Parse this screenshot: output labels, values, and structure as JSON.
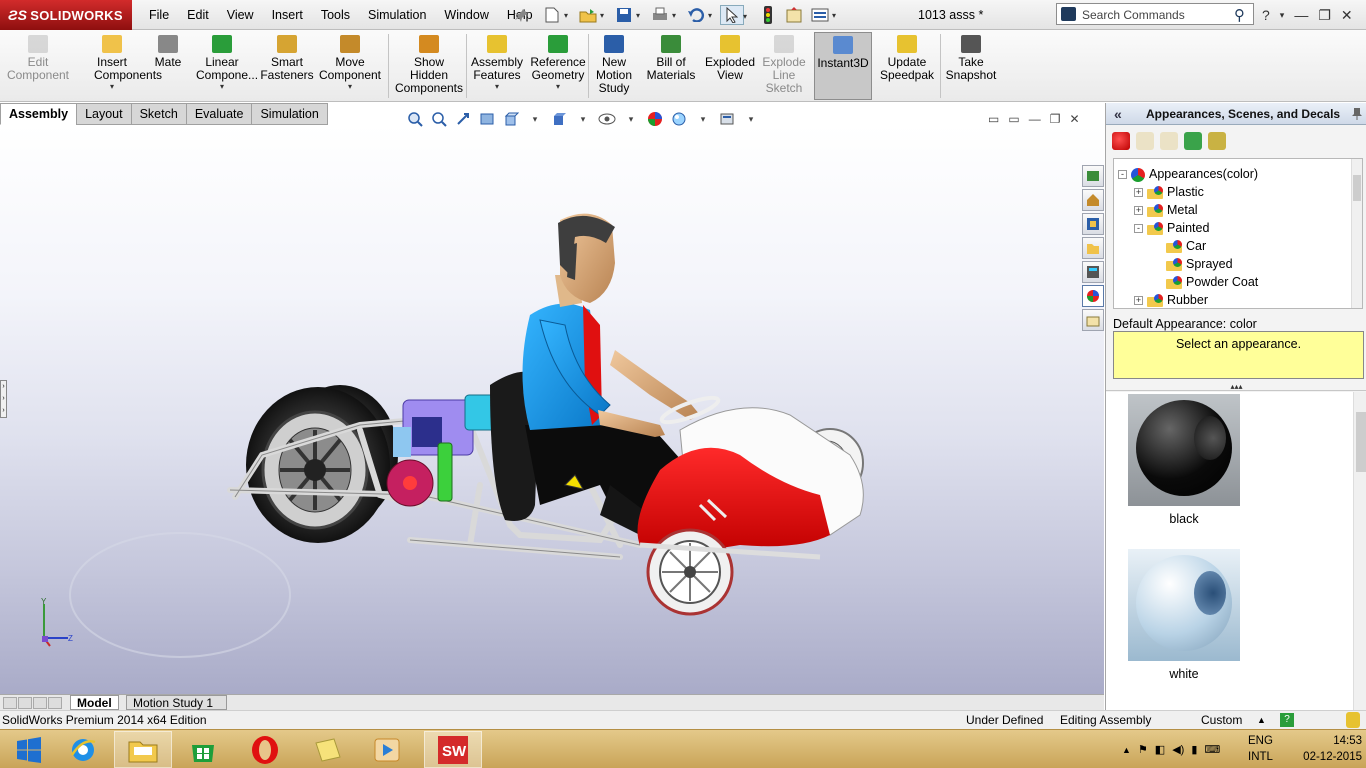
{
  "app": {
    "brand": "SOLIDWORKS",
    "document_title": "1013 asss *"
  },
  "menu": [
    "File",
    "Edit",
    "View",
    "Insert",
    "Tools",
    "Simulation",
    "Window",
    "Help"
  ],
  "search": {
    "placeholder": "Search Commands"
  },
  "toolbar": {
    "tools": [
      {
        "label": "Edit\nComponent",
        "icon": "edit-component-icon",
        "disabled": true
      },
      {
        "label": "Insert\nComponents",
        "icon": "insert-components-icon",
        "dropdown": true
      },
      {
        "label": "Mate",
        "icon": "mate-icon"
      },
      {
        "label": "Linear\nCompone...",
        "icon": "linear-pattern-icon",
        "dropdown": true
      },
      {
        "label": "Smart\nFasteners",
        "icon": "smart-fasteners-icon"
      },
      {
        "label": "Move\nComponent",
        "icon": "move-component-icon",
        "dropdown": true
      },
      {
        "label": "Show\nHidden\nComponents",
        "icon": "show-hidden-icon"
      },
      {
        "label": "Assembly\nFeatures",
        "icon": "assembly-features-icon",
        "dropdown": true
      },
      {
        "label": "Reference\nGeometry",
        "icon": "reference-geometry-icon",
        "dropdown": true
      },
      {
        "label": "New\nMotion\nStudy",
        "icon": "motion-study-icon"
      },
      {
        "label": "Bill of\nMaterials",
        "icon": "bom-icon"
      },
      {
        "label": "Exploded\nView",
        "icon": "exploded-view-icon"
      },
      {
        "label": "Explode\nLine\nSketch",
        "icon": "explode-line-icon",
        "disabled": true
      },
      {
        "label": "Instant3D",
        "icon": "instant3d-icon",
        "active": true
      },
      {
        "label": "Update\nSpeedpak",
        "icon": "speedpak-icon"
      },
      {
        "label": "Take\nSnapshot",
        "icon": "snapshot-icon"
      }
    ]
  },
  "command_tabs": [
    {
      "label": "Assembly",
      "active": true
    },
    {
      "label": "Layout"
    },
    {
      "label": "Sketch"
    },
    {
      "label": "Evaluate"
    },
    {
      "label": "Simulation"
    }
  ],
  "bottom_tabs": [
    {
      "label": "Model",
      "active": true
    },
    {
      "label": "Motion Study 1"
    }
  ],
  "status": {
    "edition": "SolidWorks Premium 2014 x64 Edition",
    "state": "Under Defined",
    "mode": "Editing Assembly",
    "units": "Custom"
  },
  "task_pane": {
    "title": "Appearances, Scenes, and Decals",
    "tree": [
      {
        "label": "Appearances(color)",
        "level": 0,
        "expander": "-"
      },
      {
        "label": "Plastic",
        "level": 1,
        "expander": "+"
      },
      {
        "label": "Metal",
        "level": 1,
        "expander": "+"
      },
      {
        "label": "Painted",
        "level": 1,
        "expander": "-"
      },
      {
        "label": "Car",
        "level": 2,
        "expander": ""
      },
      {
        "label": "Sprayed",
        "level": 2,
        "expander": ""
      },
      {
        "label": "Powder Coat",
        "level": 2,
        "expander": ""
      },
      {
        "label": "Rubber",
        "level": 1,
        "expander": "+"
      }
    ],
    "default_appearance": "Default Appearance: color",
    "hint": "Select an appearance.",
    "swatches": [
      {
        "label": "black",
        "color": "#0a0a0a"
      },
      {
        "label": "white",
        "color": "#b9d3e6"
      }
    ]
  },
  "taskbar": {
    "apps": [
      "start",
      "internet-explorer",
      "file-explorer",
      "store",
      "opera",
      "sticky-notes",
      "media-player",
      "solidworks"
    ],
    "lang_line1": "ENG",
    "lang_line2": "INTL",
    "time": "14:53",
    "date": "02-12-2015"
  }
}
